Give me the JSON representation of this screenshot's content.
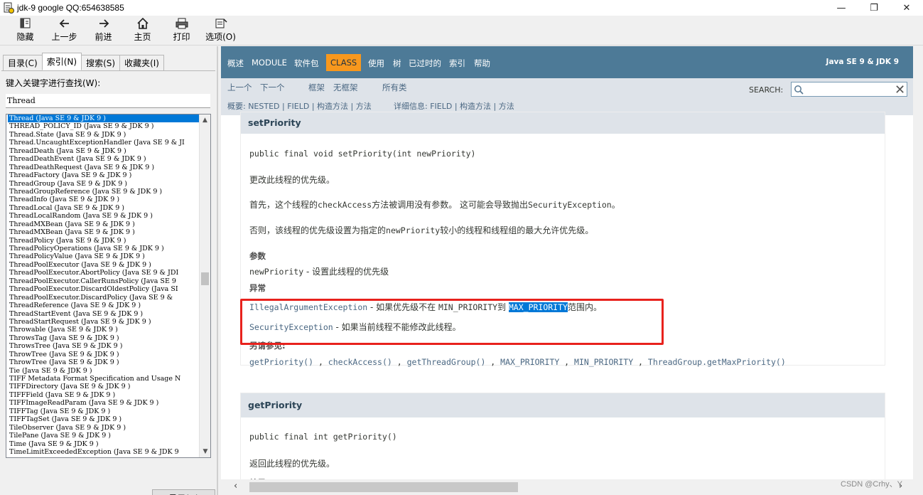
{
  "window": {
    "title": "jdk-9 google QQ:654638585"
  },
  "toolbar": [
    {
      "label": "隐藏",
      "icon": "hide-icon"
    },
    {
      "label": "上一步",
      "icon": "back-arrow-icon"
    },
    {
      "label": "前进",
      "icon": "forward-arrow-icon"
    },
    {
      "label": "主页",
      "icon": "home-icon"
    },
    {
      "label": "打印",
      "icon": "print-icon"
    },
    {
      "label": "选项(O)",
      "icon": "options-icon"
    }
  ],
  "left": {
    "tabs": [
      "目录(C)",
      "索引(N)",
      "搜索(S)",
      "收藏夹(I)"
    ],
    "active_tab": "索引(N)",
    "keyword_label": "键入关键字进行查找(W):",
    "keyword_value": "Thread",
    "show_button": "显示(D)",
    "index_items": [
      "Thread (Java SE 9 & JDK 9 )",
      "THREAD_POLICY_ID (Java SE 9 & JDK 9 )",
      "Thread.State (Java SE 9 & JDK 9 )",
      "Thread.UncaughtExceptionHandler (Java SE 9 & JI",
      "ThreadDeath (Java SE 9 & JDK 9 )",
      "ThreadDeathEvent (Java SE 9 & JDK 9 )",
      "ThreadDeathRequest (Java SE 9 & JDK 9 )",
      "ThreadFactory (Java SE 9 & JDK 9 )",
      "ThreadGroup (Java SE 9 & JDK 9 )",
      "ThreadGroupReference (Java SE 9 & JDK 9 )",
      "ThreadInfo (Java SE 9 & JDK 9 )",
      "ThreadLocal (Java SE 9 & JDK 9 )",
      "ThreadLocalRandom (Java SE 9 & JDK 9 )",
      "ThreadMXBean (Java SE 9 & JDK 9 )",
      "ThreadMXBean (Java SE 9 & JDK 9 )",
      "ThreadPolicy (Java SE 9 & JDK 9 )",
      "ThreadPolicyOperations (Java SE 9 & JDK 9 )",
      "ThreadPolicyValue (Java SE 9 & JDK 9 )",
      "ThreadPoolExecutor (Java SE 9 & JDK 9 )",
      "ThreadPoolExecutor.AbortPolicy (Java SE 9 & JDI",
      "ThreadPoolExecutor.CallerRunsPolicy (Java SE 9",
      "ThreadPoolExecutor.DiscardOldestPolicy (Java SI",
      "ThreadPoolExecutor.DiscardPolicy (Java SE 9 &",
      "ThreadReference (Java SE 9 & JDK 9 )",
      "ThreadStartEvent (Java SE 9 & JDK 9 )",
      "ThreadStartRequest (Java SE 9 & JDK 9 )",
      "Throwable (Java SE 9 & JDK 9 )",
      "ThrowsTag (Java SE 9 & JDK 9 )",
      "ThrowsTree (Java SE 9 & JDK 9 )",
      "ThrowTree (Java SE 9 & JDK 9 )",
      "ThrowTree (Java SE 9 & JDK 9 )",
      "Tie (Java SE 9 & JDK 9 )",
      "TIFF Metadata Format Specification and Usage N",
      "TIFFDirectory (Java SE 9 & JDK 9 )",
      "TIFFField (Java SE 9 & JDK 9 )",
      "TIFFImageReadParam (Java SE 9 & JDK 9 )",
      "TIFFTag (Java SE 9 & JDK 9 )",
      "TIFFTagSet (Java SE 9 & JDK 9 )",
      "TileObserver (Java SE 9 & JDK 9 )",
      "TilePane (Java SE 9 & JDK 9 )",
      "Time (Java SE 9 & JDK 9 )",
      "TimeLimitExceededException (Java SE 9 & JDK 9"
    ]
  },
  "nav": {
    "items": [
      "概述",
      "MODULE",
      "软件包",
      "CLASS",
      "使用",
      "树",
      "已过时的",
      "索引",
      "帮助"
    ],
    "active": "CLASS",
    "brand": "Java SE 9 & JDK 9"
  },
  "subnav": {
    "prev": "上一个",
    "next": "下一个",
    "frames": "框架",
    "noframes": "无框架",
    "allclasses": "所有类",
    "search_label": "SEARCH:",
    "summary": "概要: NESTED | FIELD | 构造方法 | 方法",
    "detail": "详细信息: FIELD | 构造方法 | 方法"
  },
  "setPriority": {
    "heading": "setPriority",
    "signature": "public final void setPriority(int newPriority)",
    "desc1": "更改此线程的优先级。",
    "desc2_a": "首先，这个线程的",
    "desc2_code1": "checkAccess",
    "desc2_b": "方法被调用没有参数。 这可能会导致抛出",
    "desc2_code2": "SecurityException",
    "desc2_c": "。",
    "desc3_a": "否则，该线程的优先级设置为指定的",
    "desc3_code": "newPriority",
    "desc3_b": "较小的线程和线程组的最大允许优先级。",
    "params_label": "参数",
    "param_name": "newPriority",
    "param_desc": " - 设置此线程的优先级",
    "throws_label": "异常",
    "exc1_name": "IllegalArgumentException",
    "exc1_a": " - 如果优先级不在 ",
    "exc1_code1": "MIN_PRIORITY",
    "exc1_b": "到 ",
    "exc1_code2": "MAX_PRIORITY",
    "exc1_c": "范围内。",
    "exc2_name": "SecurityException",
    "exc2_desc": " - 如果当前线程不能修改此线程。",
    "seealso_label": "另请参见:",
    "seealso": [
      "getPriority()",
      "checkAccess()",
      "getThreadGroup()",
      "MAX_PRIORITY",
      "MIN_PRIORITY",
      "ThreadGroup.getMaxPriority()"
    ]
  },
  "getPriority": {
    "heading": "getPriority",
    "signature": "public final int getPriority()",
    "desc1": "返回此线程的优先级。",
    "cut": "结果"
  },
  "watermark": "CSDN @Crhy、Y",
  "colors": {
    "nav": "#4d7a97",
    "active_tab": "#f8981d",
    "highlight_box": "#e8221d",
    "selection": "#0078d7"
  }
}
